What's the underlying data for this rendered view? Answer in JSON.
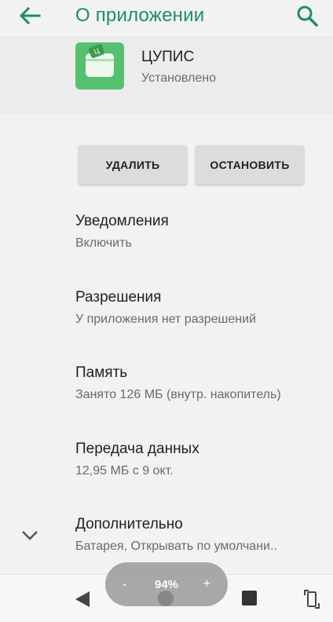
{
  "appbar": {
    "title": "О приложении"
  },
  "app": {
    "name": "ЦУПИС",
    "status": "Установлено",
    "icon_badge": "Ц"
  },
  "buttons": {
    "uninstall": "УДАЛИТЬ",
    "stop": "ОСТАНОВИТЬ"
  },
  "items": [
    {
      "title": "Уведомления",
      "subtitle": "Включить"
    },
    {
      "title": "Разрешения",
      "subtitle": "У приложения нет разрешений"
    },
    {
      "title": "Память",
      "subtitle": "Занято 126 МБ (внутр. накопитель)"
    },
    {
      "title": "Передача данных",
      "subtitle": "12,95 МБ с 9 окт."
    },
    {
      "title": "Дополнительно",
      "subtitle": "Батарея, Открывать по умолчани.."
    }
  ],
  "zoom": {
    "minus": "-",
    "value": "94%",
    "plus": "+"
  },
  "colors": {
    "accent": "#1f8a70",
    "app_icon": "#55c06f",
    "background": "#f2f2f2"
  },
  "icons": [
    "back-arrow-icon",
    "search-icon",
    "chevron-down-icon",
    "nav-back-icon",
    "nav-home-icon",
    "nav-recents-icon",
    "rotate-icon"
  ]
}
